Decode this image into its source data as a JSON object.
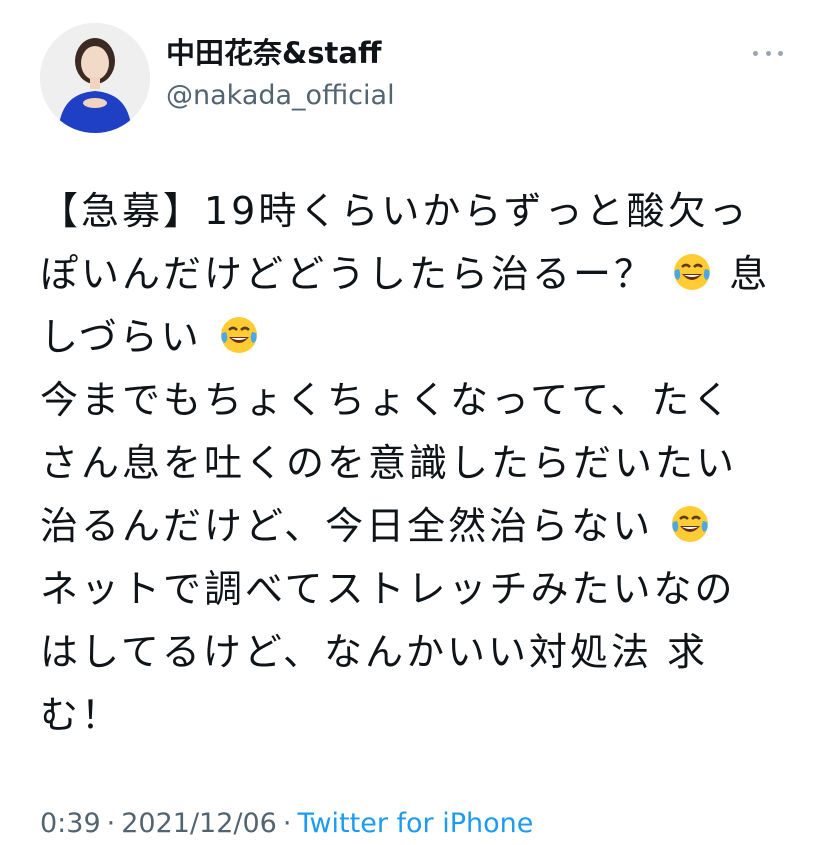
{
  "author": {
    "display_name": "中田花奈&staff",
    "handle": "@nakada_official",
    "avatar_icon": "profile-photo-icon",
    "more_icon": "more-options-icon"
  },
  "tweet": {
    "lines": [
      {
        "text": "【急募】19時くらいからずっと酸欠っ",
        "emoji": ""
      },
      {
        "text": "ぽいんだけどどうしたら治るー？",
        "emoji": "face-with-tears-of-joy",
        "text_after": "息"
      },
      {
        "text": "しづらい",
        "emoji": "face-with-tears-of-joy",
        "text_after": ""
      },
      {
        "text": "今までもちょくちょくなってて、たく",
        "emoji": ""
      },
      {
        "text": "さん息を吐くのを意識したらだいたい",
        "emoji": ""
      },
      {
        "text": "治るんだけど、今日全然治らない",
        "emoji": "face-with-tears-of-joy",
        "text_after": ""
      },
      {
        "text": "ネットで調べてストレッチみたいなの",
        "emoji": ""
      },
      {
        "text": "はしてるけど、なんかいい対処法 求",
        "emoji": ""
      },
      {
        "text": "む！",
        "emoji": ""
      }
    ]
  },
  "meta": {
    "time": "0:39",
    "date": "2021/12/06",
    "separator": "·",
    "source": "Twitter for iPhone"
  },
  "colors": {
    "text": "#0f1419",
    "secondary": "#536471",
    "link": "#1d9bf0",
    "emoji_yellow": "#ffcc33"
  }
}
